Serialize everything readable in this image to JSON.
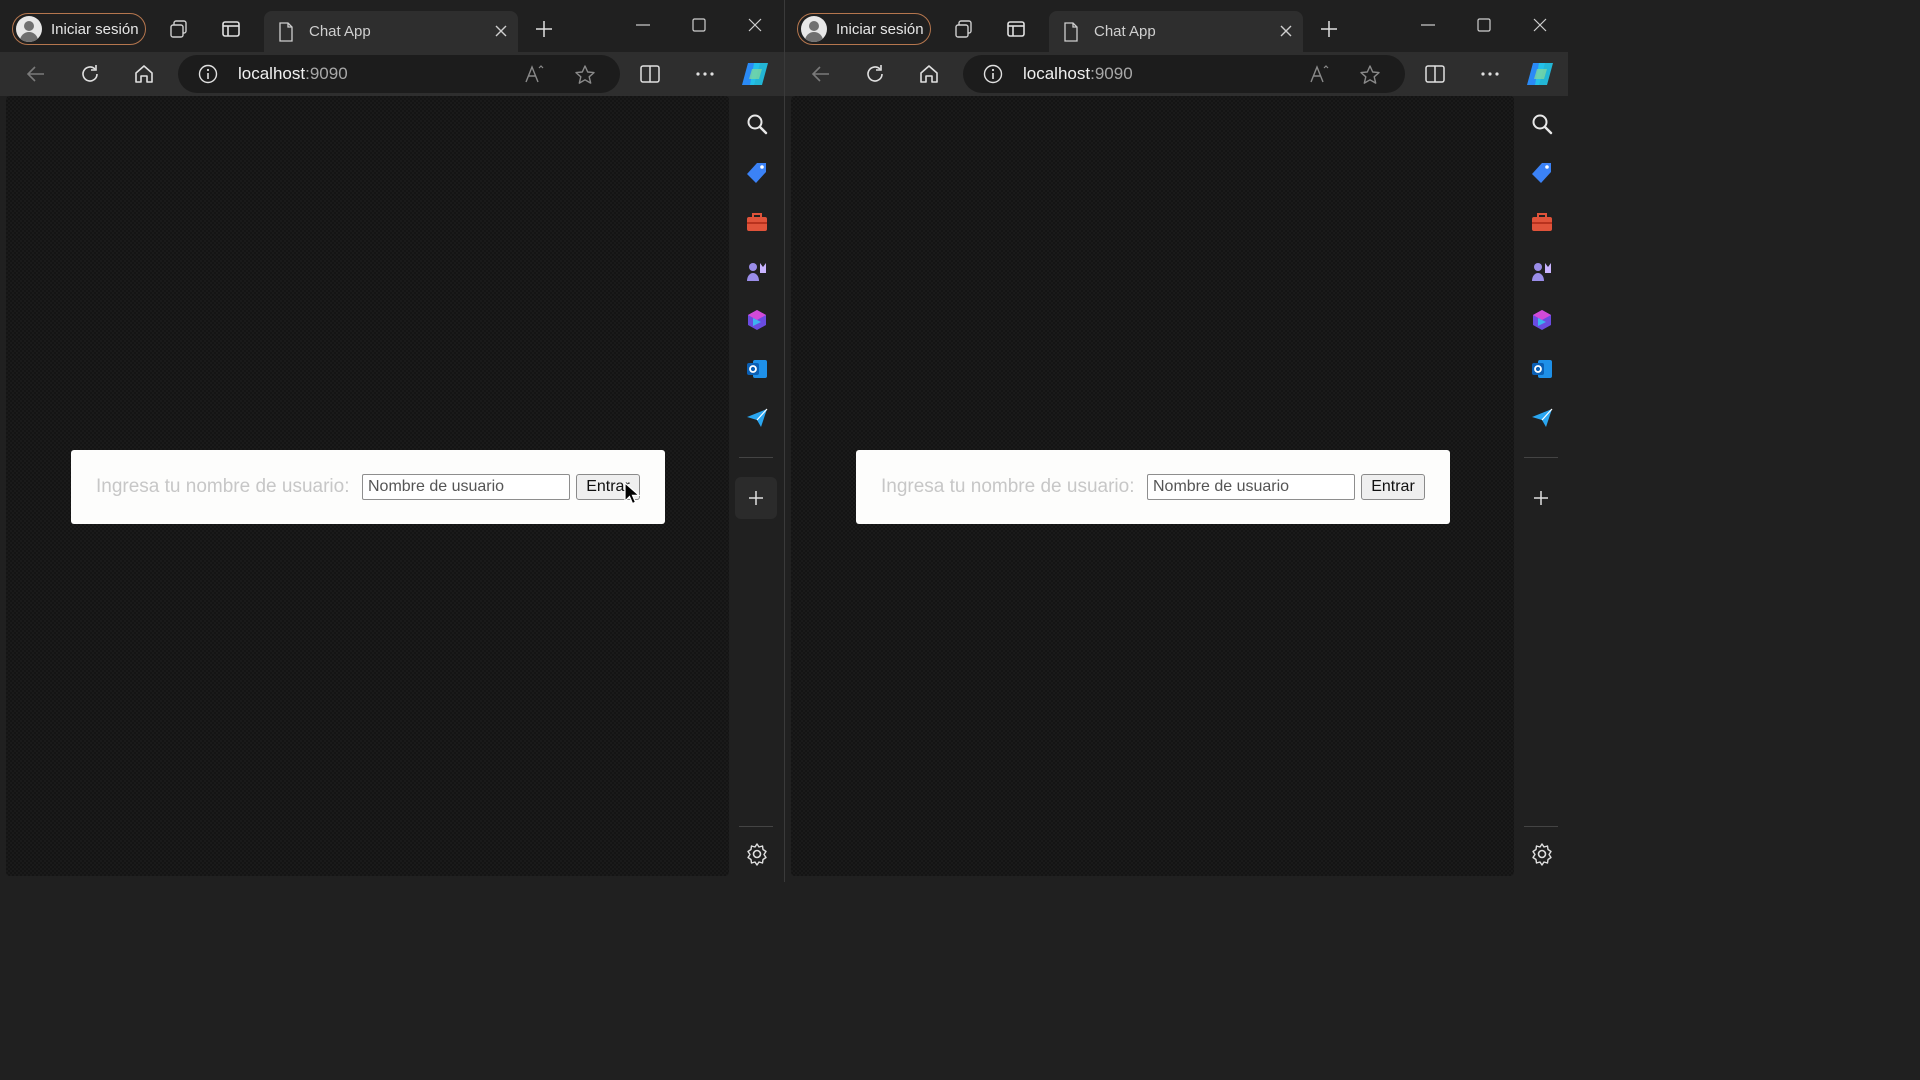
{
  "windows": [
    {
      "id": "left",
      "profile_label": "Iniciar sesión",
      "tab_title": "Chat App",
      "url_host": "localhost",
      "url_port": ":9090",
      "login": {
        "label": "Ingresa tu nombre de usuario:",
        "placeholder": "Nombre de usuario",
        "button": "Entrar"
      },
      "cursor_visible": true
    },
    {
      "id": "right",
      "profile_label": "Iniciar sesión",
      "tab_title": "Chat App",
      "url_host": "localhost",
      "url_port": ":9090",
      "login": {
        "label": "Ingresa tu nombre de usuario:",
        "placeholder": "Nombre de usuario",
        "button": "Entrar"
      },
      "cursor_visible": false
    }
  ],
  "sidebar_icons": [
    "search-icon",
    "shopping-tag-icon",
    "toolbox-icon",
    "games-icon",
    "microsoft-365-icon",
    "outlook-icon",
    "send-icon"
  ],
  "colors": {
    "chrome": "#202020",
    "toolbar": "#2e2e2e",
    "content_bg": "#141414",
    "card_bg": "#fdfdfc",
    "profile_border": "#b5764e",
    "label_text": "#c7c7c7"
  }
}
